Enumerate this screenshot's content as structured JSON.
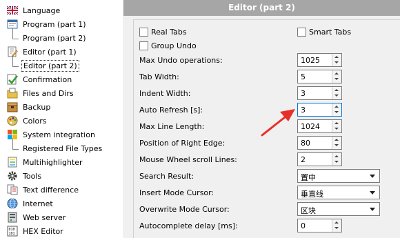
{
  "sidebar": {
    "items": [
      {
        "label": "Language",
        "icon": "uk-flag-icon"
      },
      {
        "label": "Program  (part 1)",
        "icon": "program-window-icon"
      },
      {
        "label": "Program  (part 2)",
        "icon": ""
      },
      {
        "label": "Editor  (part 1)",
        "icon": "editor-pencil-icon"
      },
      {
        "label": "Editor  (part 2)",
        "icon": ""
      },
      {
        "label": "Confirmation",
        "icon": "checkmark-icon"
      },
      {
        "label": "Files and Dirs",
        "icon": "folder-files-icon"
      },
      {
        "label": "Backup",
        "icon": "backup-box-icon"
      },
      {
        "label": "Colors",
        "icon": "palette-icon"
      },
      {
        "label": "System integration",
        "icon": "windows-logo-icon"
      },
      {
        "label": "Registered File Types",
        "icon": ""
      },
      {
        "label": "Multihighlighter",
        "icon": "multihighlight-icon"
      },
      {
        "label": "Tools",
        "icon": "gear-icon"
      },
      {
        "label": "Text difference",
        "icon": "text-diff-icon"
      },
      {
        "label": "Internet",
        "icon": "globe-icon"
      },
      {
        "label": "Web server",
        "icon": "web-server-icon"
      },
      {
        "label": "HEX Editor",
        "icon": "hex-binary-icon"
      }
    ],
    "selected_index": 4
  },
  "panel": {
    "title": "Editor  (part 2)",
    "checkboxes": [
      {
        "label": "Real Tabs",
        "checked": false
      },
      {
        "label": "Smart Tabs",
        "checked": false
      },
      {
        "label": "Group Undo",
        "checked": false
      }
    ],
    "spin_rows": [
      {
        "label": "Max Undo operations:",
        "value": "1025"
      },
      {
        "label": "Tab Width:",
        "value": "5"
      },
      {
        "label": "Indent Width:",
        "value": "3"
      },
      {
        "label": "Auto Refresh [s]:",
        "value": "3"
      },
      {
        "label": "Max Line Length:",
        "value": "1024"
      },
      {
        "label": "Position of Right Edge:",
        "value": "80"
      },
      {
        "label": "Mouse Wheel scroll Lines:",
        "value": "2"
      }
    ],
    "select_rows": [
      {
        "label": "Search Result:",
        "value": "置中"
      },
      {
        "label": "Insert Mode Cursor:",
        "value": "垂直线"
      },
      {
        "label": "Overwrite Mode Cursor:",
        "value": "区块"
      }
    ],
    "last_row": {
      "label": "Autocomplete delay [ms]:",
      "value": "0"
    }
  },
  "annotation": {
    "color": "#e8302a",
    "target": "Auto Refresh [s]"
  }
}
